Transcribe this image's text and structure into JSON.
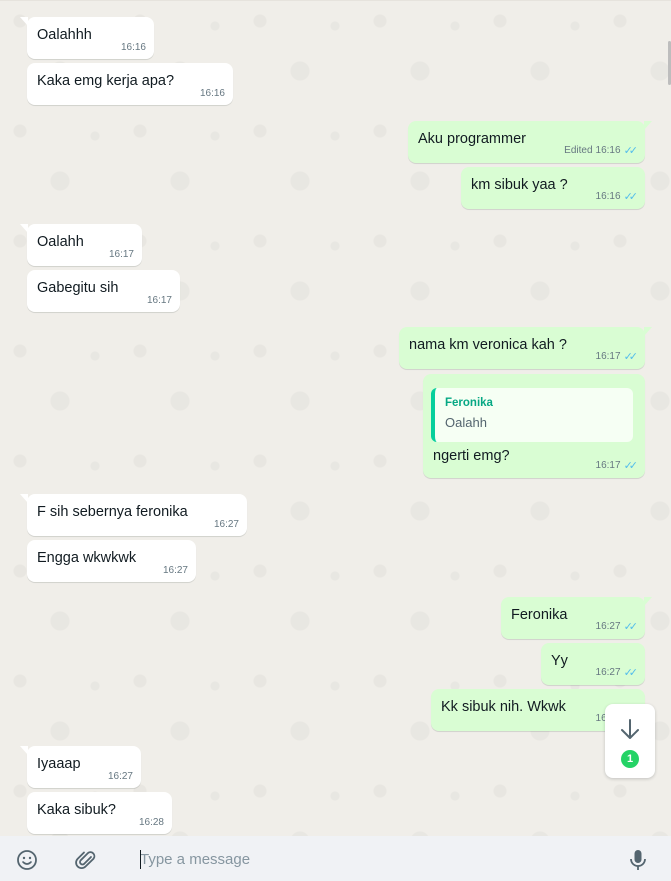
{
  "messages": [
    {
      "dir": "in",
      "text": "Oalahhh",
      "time": "16:16"
    },
    {
      "dir": "in",
      "text": "Kaka emg kerja apa?",
      "time": "16:16"
    },
    {
      "dir": "out",
      "text": "Aku programmer",
      "time": "16:16",
      "edited": "Edited"
    },
    {
      "dir": "out",
      "text": "km sibuk yaa ?",
      "time": "16:16"
    },
    {
      "dir": "in",
      "text": "Oalahh",
      "time": "16:17"
    },
    {
      "dir": "in",
      "text": "Gabegitu sih",
      "time": "16:17"
    },
    {
      "dir": "out",
      "text": "nama km veronica kah ?",
      "time": "16:17"
    },
    {
      "dir": "out",
      "text": "ngerti emg?",
      "time": "16:17",
      "quote": {
        "author": "Feronika",
        "text": "Oalahh"
      }
    },
    {
      "dir": "in",
      "text": "F sih sebernya feronika",
      "time": "16:27"
    },
    {
      "dir": "in",
      "text": "Engga wkwkwk",
      "time": "16:27"
    },
    {
      "dir": "out",
      "text": "Feronika",
      "time": "16:27"
    },
    {
      "dir": "out",
      "text": "Yy",
      "time": "16:27"
    },
    {
      "dir": "out",
      "text": "Kk sibuk nih. Wkwk",
      "time": "16:27"
    },
    {
      "dir": "in",
      "text": "Iyaaap",
      "time": "16:27"
    },
    {
      "dir": "in",
      "text": "Kaka sibuk?",
      "time": "16:28"
    }
  ],
  "scroll_button": {
    "icon": "arrow-down-icon",
    "unread_count": "1"
  },
  "composer": {
    "placeholder": "Type a message",
    "emoji_icon": "emoji-icon",
    "attach_icon": "paperclip-icon",
    "mic_icon": "microphone-icon"
  },
  "colors": {
    "incoming_bubble": "#ffffff",
    "outgoing_bubble": "#d9fdd3",
    "read_ticks": "#53bdeb",
    "badge": "#25d366",
    "quote_accent": "#06cf9c"
  }
}
